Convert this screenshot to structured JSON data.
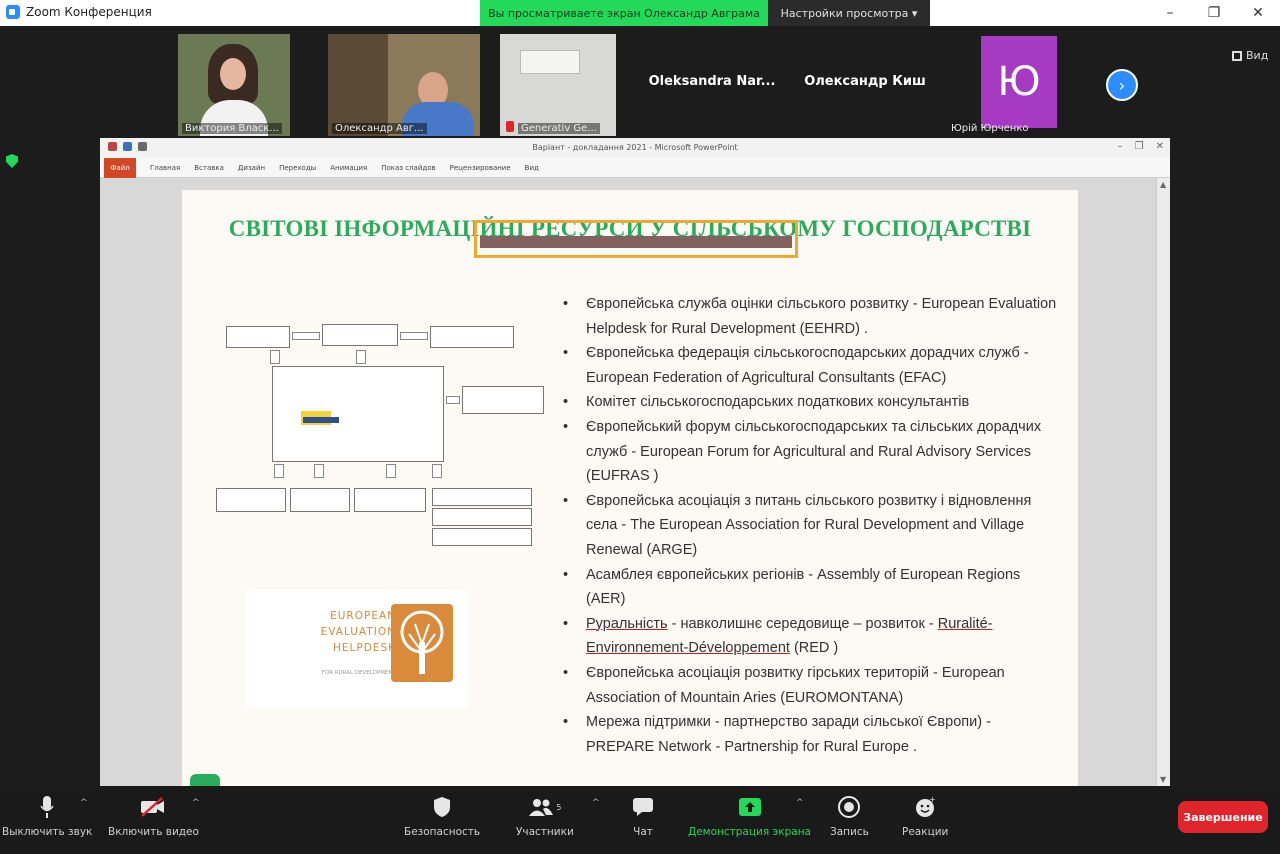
{
  "window": {
    "app_title": "Zoom Конференция",
    "share_banner": "Вы просматриваете экран Олександр Авграма",
    "view_options": "Настройки просмотра ▾",
    "minimize": "–",
    "restore": "❐",
    "close": "✕"
  },
  "gallery": {
    "participants": [
      {
        "name": "Виктория Власк..."
      },
      {
        "name": "Олександр Авг..."
      },
      {
        "name": "Generativ Ge..."
      },
      {
        "name": "Oleksandra  Nar..."
      },
      {
        "name": "Олександр Киш"
      },
      {
        "name": "Юрій Юрченко",
        "initial": "Ю"
      }
    ],
    "view_label": "Вид",
    "next_label": "›"
  },
  "ppt": {
    "title": "Варіант - докладання 2021 - Microsoft PowerPoint",
    "tabs": [
      "Файл",
      "Главная",
      "Вставка",
      "Дизайн",
      "Переходы",
      "Анимация",
      "Показ слайдов",
      "Рецензирование",
      "Вид"
    ]
  },
  "slide": {
    "title": "СВІТОВІ ІНФОРМАЦІЙНІ РЕСУРСИ У СІЛЬСЬКОМУ ГОСПОДАРСТВІ",
    "bullets": [
      "Європейська служба оцінки сільського розвитку - European Evaluation Helpdesk for Rural Development (EEHRD) .",
      "Європейська федерація сільськогосподарських дорадчих служб - European Federation of Agricultural Consultants (EFAC)",
      "Комітет сільськогосподарських податкових консультантів",
      "Європейський форум сільськогосподарських та сільських дорадчих служб - European Forum for Agricultural and Rural Advisory Services (EUFRAS )",
      "Європейська асоціація з питань сільського розвитку і відновлення села - The European Association for Rural Development and Village Renewal (ARGE)",
      "Асамблея європейських регіонів - Assembly of European Regions (AER)",
      "",
      "Європейська асоціація розвитку гірських територій - European Association of Mountain Aries (EUROMONTANA)",
      "Мережа підтримки - партнерство заради сільської Європи) - PREPARE Network - Partnership for Rural Europe ."
    ],
    "bullet7": {
      "word1": "Руральність",
      "mid": " - навколишнє середовище – розвиток - ",
      "word2": "Ruralité-Environnement-Développement",
      "tail": " (RED )"
    },
    "logo_text": [
      "EUROPEAN",
      "EVALUATION",
      "HELPDESK"
    ],
    "logo_sub": "FOR RURAL DEVELOPMENT"
  },
  "toolbar": {
    "mute": "Выключить звук",
    "video": "Включить видео",
    "security": "Безопасность",
    "participants": "Участники",
    "participants_count": "5",
    "chat": "Чат",
    "share": "Демонстрация экрана",
    "record": "Запись",
    "reactions": "Реакции",
    "end": "Завершение"
  }
}
